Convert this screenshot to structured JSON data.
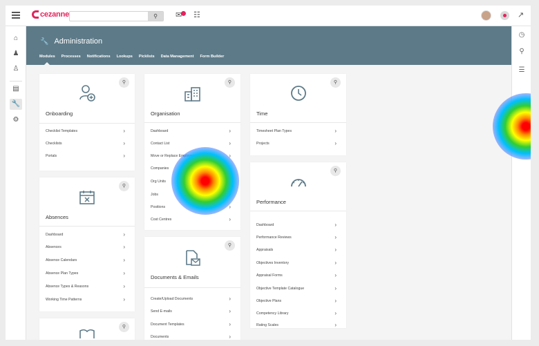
{
  "app": {
    "brand": "cezanne",
    "brand_color": "#e0245e",
    "header_color": "#5d7a88"
  },
  "topbar": {
    "search_placeholder": "",
    "search_icon": "search-icon",
    "mail_badge": ""
  },
  "header": {
    "title": "Administration",
    "icon": "wrench-icon"
  },
  "tabs": [
    {
      "label": "Modules",
      "active": true
    },
    {
      "label": "Processes"
    },
    {
      "label": "Notifications"
    },
    {
      "label": "Lookups"
    },
    {
      "label": "Picklists"
    },
    {
      "label": "Data Management"
    },
    {
      "label": "Form Builder"
    }
  ],
  "cards": {
    "onboarding": {
      "title": "Onboarding",
      "items": [
        "Checklist Templates",
        "Checklists",
        "Portals"
      ]
    },
    "absences": {
      "title": "Absences",
      "items": [
        "Dashboard",
        "Absences",
        "Absence Calendars",
        "Absence Plan Types",
        "Absence Types & Reasons",
        "Working Time Patterns"
      ]
    },
    "organisation": {
      "title": "Organisation",
      "items": [
        "Dashboard",
        "Contact List",
        "Move or Replace Employees",
        "Companies",
        "Org Units",
        "Jobs",
        "Positions",
        "Cost Centres"
      ]
    },
    "documents": {
      "title": "Documents & Emails",
      "items": [
        "Create/Upload Documents",
        "Send E-mails",
        "Document Templates",
        "Documents"
      ]
    },
    "time": {
      "title": "Time",
      "items": [
        "Timesheet Plan Types",
        "Projects"
      ]
    },
    "performance": {
      "title": "Performance",
      "items": [
        "Dashboard",
        "Performance Reviews",
        "Appraisals",
        "Objectives Inventory",
        "Appraisal Forms",
        "Objective Template Catalogue",
        "Objective Plans",
        "Competency Library",
        "Rating Scales"
      ]
    }
  }
}
